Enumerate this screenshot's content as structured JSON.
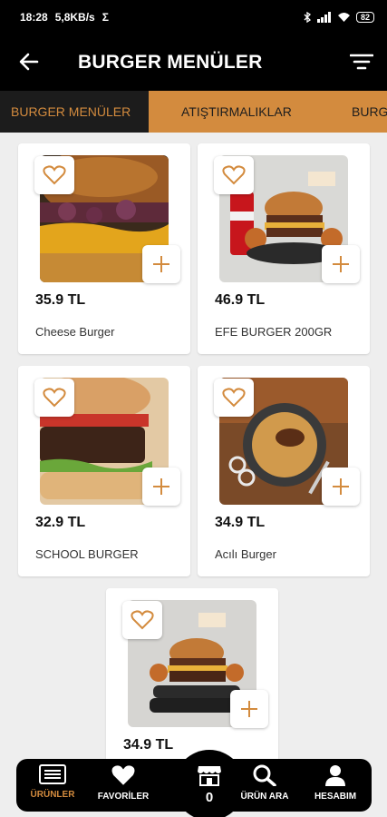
{
  "status": {
    "time": "18:28",
    "net_speed": "5,8KB/s",
    "sigma": "Σ",
    "battery": "82"
  },
  "app_bar": {
    "title": "BURGER MENÜLER"
  },
  "tabs": [
    "BURGER MENÜLER",
    "ATIŞTIRMALIKLAR",
    "BURG"
  ],
  "products": [
    {
      "price": "35.9 TL",
      "name": "Cheese Burger"
    },
    {
      "price": "46.9 TL",
      "name": "EFE BURGER 200GR"
    },
    {
      "price": "32.9 TL",
      "name": "SCHOOL BURGER"
    },
    {
      "price": "34.9 TL",
      "name": "Acılı Burger"
    },
    {
      "price": "34.9 TL",
      "name": ""
    }
  ],
  "bottom_nav": {
    "items": [
      "ÜRÜNLER",
      "FAVORİLER",
      "ÜRÜN ARA",
      "HESABIM"
    ],
    "cart_count": "0"
  },
  "colors": {
    "accent": "#d38b3e",
    "bar": "#000000",
    "background": "#eeeeee"
  },
  "icons": [
    "back-arrow-icon",
    "filter-icon",
    "heart-icon",
    "plus-icon",
    "list-icon",
    "heart-filled-icon",
    "store-icon",
    "search-icon",
    "user-icon"
  ]
}
